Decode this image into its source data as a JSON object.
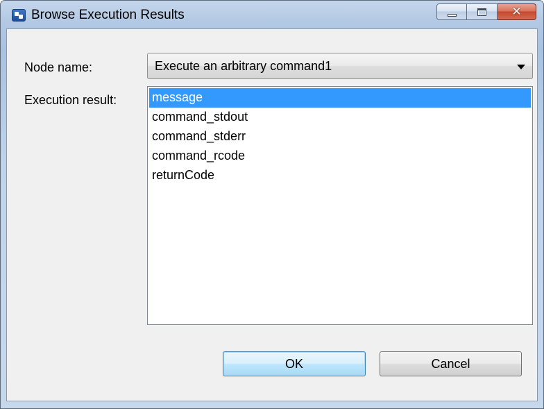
{
  "window": {
    "title": "Browse Execution Results",
    "close_glyph": "✕"
  },
  "form": {
    "node_label": "Node name:",
    "node_value": "Execute an arbitrary command1",
    "result_label": "Execution result:",
    "results": [
      {
        "label": "message",
        "selected": true
      },
      {
        "label": "command_stdout",
        "selected": false
      },
      {
        "label": "command_stderr",
        "selected": false
      },
      {
        "label": "command_rcode",
        "selected": false
      },
      {
        "label": "returnCode",
        "selected": false
      }
    ]
  },
  "buttons": {
    "ok_label": "OK",
    "cancel_label": "Cancel"
  },
  "colors": {
    "selection": "#3399ff",
    "close_button": "#c44a2f"
  },
  "icons": {
    "app": "app-icon",
    "minimize": "minimize-icon",
    "maximize": "maximize-icon",
    "close": "close-icon",
    "dropdown": "chevron-down-icon"
  }
}
